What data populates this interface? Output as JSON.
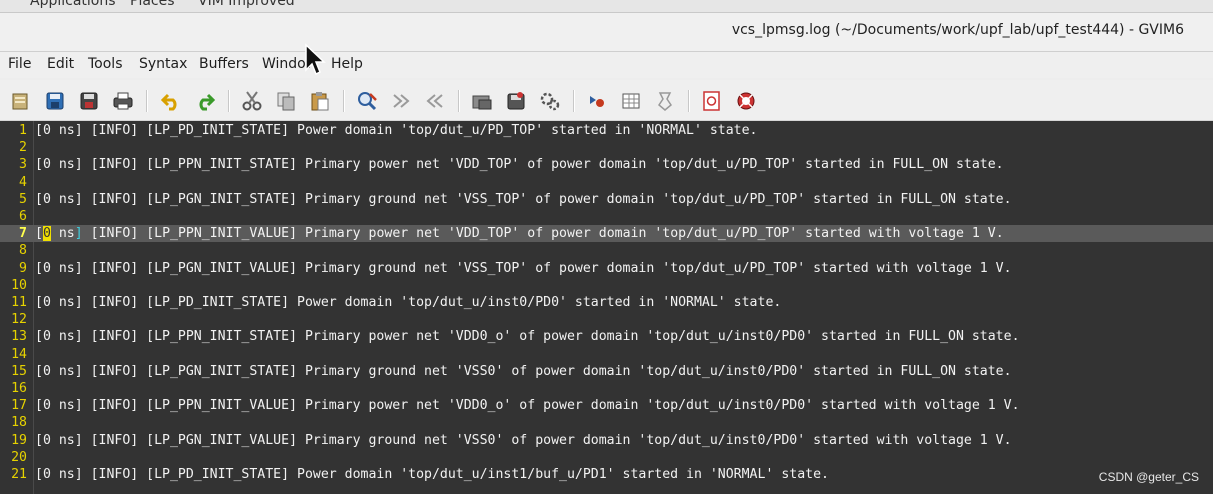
{
  "panel": {
    "applications": "Applications",
    "places": "Places",
    "app": "VIM Improved"
  },
  "window": {
    "title": "vcs_lpmsg.log (~/Documents/work/upf_lab/upf_test444) - GVIM6"
  },
  "menu": {
    "file": "File",
    "edit": "Edit",
    "tools": "Tools",
    "syntax": "Syntax",
    "buffers": "Buffers",
    "window": "Window",
    "help": "Help"
  },
  "toolbar_icons": [
    "open-icon",
    "save-icon",
    "save-all-icon",
    "print-icon",
    "undo-icon",
    "redo-icon",
    "cut-icon",
    "copy-icon",
    "paste-icon",
    "find-replace-icon",
    "find-next-icon",
    "find-prev-icon",
    "load-session-icon",
    "save-session-icon",
    "run-script-icon",
    "make-icon",
    "shell-icon",
    "run-ctags-icon",
    "tag-jump-icon",
    "help-icon",
    "find-help-icon"
  ],
  "editor": {
    "current_line": 7,
    "lines": [
      {
        "n": "1",
        "t": "[0 ns] [INFO] [LP_PD_INIT_STATE] Power domain 'top/dut_u/PD_TOP' started in 'NORMAL' state."
      },
      {
        "n": "2",
        "t": ""
      },
      {
        "n": "3",
        "t": "[0 ns] [INFO] [LP_PPN_INIT_STATE] Primary power net 'VDD_TOP' of power domain 'top/dut_u/PD_TOP' started in FULL_ON state."
      },
      {
        "n": "4",
        "t": ""
      },
      {
        "n": "5",
        "t": "[0 ns] [INFO] [LP_PGN_INIT_STATE] Primary ground net 'VSS_TOP' of power domain 'top/dut_u/PD_TOP' started in FULL_ON state."
      },
      {
        "n": "6",
        "t": ""
      },
      {
        "n": "7",
        "t": "[0 ns] [INFO] [LP_PPN_INIT_VALUE] Primary power net 'VDD_TOP' of power domain 'top/dut_u/PD_TOP' started with voltage 1 V."
      },
      {
        "n": "8",
        "t": ""
      },
      {
        "n": "9",
        "t": "[0 ns] [INFO] [LP_PGN_INIT_VALUE] Primary ground net 'VSS_TOP' of power domain 'top/dut_u/PD_TOP' started with voltage 1 V."
      },
      {
        "n": "10",
        "t": ""
      },
      {
        "n": "11",
        "t": "[0 ns] [INFO] [LP_PD_INIT_STATE] Power domain 'top/dut_u/inst0/PD0' started in 'NORMAL' state."
      },
      {
        "n": "12",
        "t": ""
      },
      {
        "n": "13",
        "t": "[0 ns] [INFO] [LP_PPN_INIT_STATE] Primary power net 'VDD0_o' of power domain 'top/dut_u/inst0/PD0' started in FULL_ON state."
      },
      {
        "n": "14",
        "t": ""
      },
      {
        "n": "15",
        "t": "[0 ns] [INFO] [LP_PGN_INIT_STATE] Primary ground net 'VSS0' of power domain 'top/dut_u/inst0/PD0' started in FULL_ON state."
      },
      {
        "n": "16",
        "t": ""
      },
      {
        "n": "17",
        "t": "[0 ns] [INFO] [LP_PPN_INIT_VALUE] Primary power net 'VDD0_o' of power domain 'top/dut_u/inst0/PD0' started with voltage 1 V."
      },
      {
        "n": "18",
        "t": ""
      },
      {
        "n": "19",
        "t": "[0 ns] [INFO] [LP_PGN_INIT_VALUE] Primary ground net 'VSS0' of power domain 'top/dut_u/inst0/PD0' started with voltage 1 V."
      },
      {
        "n": "20",
        "t": ""
      },
      {
        "n": "21",
        "t": "[0 ns] [INFO] [LP_PD_INIT_STATE] Power domain 'top/dut_u/inst1/buf_u/PD1' started in 'NORMAL' state."
      }
    ],
    "cursor_line_prefix": "[",
    "cursor_char": "0",
    "cursor_line_mid": " ns",
    "cursor_bracket": "]",
    "cursor_line_rest": " [INFO] [LP_PPN_INIT_VALUE] Primary power net 'VDD_TOP' of power domain 'top/dut_u/PD_TOP' started with voltage 1 V."
  },
  "watermark": "CSDN @geter_CS"
}
